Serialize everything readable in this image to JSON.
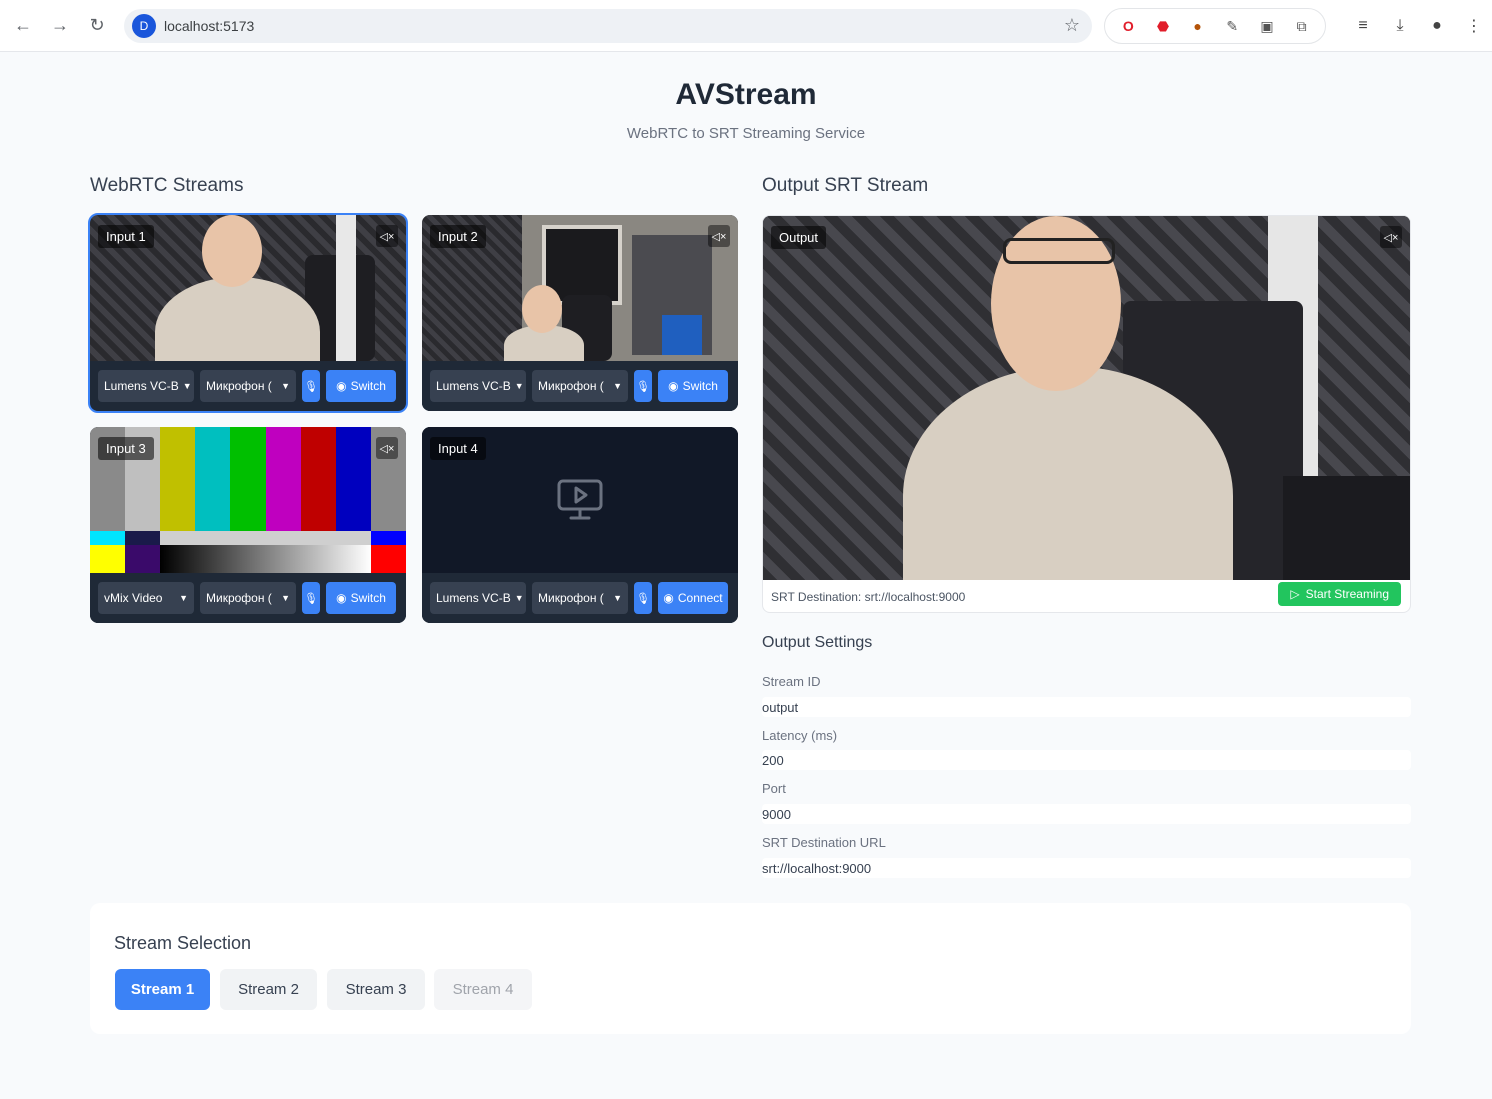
{
  "browser": {
    "url": "localhost:5173",
    "site_icon": "D"
  },
  "header": {
    "title": "AVStream",
    "subtitle": "WebRTC to SRT Streaming Service"
  },
  "webrtc": {
    "section_title": "WebRTC Streams",
    "inputs": [
      {
        "label": "Input 1",
        "video_select": "Lumens VC-B",
        "audio_select": "Микрофон (",
        "action": "Switch",
        "active": true
      },
      {
        "label": "Input 2",
        "video_select": "Lumens VC-B",
        "audio_select": "Микрофон (",
        "action": "Switch",
        "active": false
      },
      {
        "label": "Input 3",
        "video_select": "vMix Video",
        "audio_select": "Микрофон (",
        "action": "Switch",
        "active": false
      },
      {
        "label": "Input 4",
        "video_select": "Lumens VC-B",
        "audio_select": "Микрофон (",
        "action": "Connect",
        "active": false
      }
    ]
  },
  "output": {
    "section_title": "Output SRT Stream",
    "video_label": "Output",
    "destination_text": "SRT Destination: srt://localhost:9000",
    "start_button": "Start Streaming",
    "settings": {
      "title": "Output Settings",
      "stream_id_label": "Stream ID",
      "stream_id": "output",
      "latency_label": "Latency (ms)",
      "latency": "200",
      "port_label": "Port",
      "port": "9000",
      "url_label": "SRT Destination URL",
      "url": "srt://localhost:9000"
    }
  },
  "stream_selection": {
    "title": "Stream Selection",
    "buttons": [
      "Stream 1",
      "Stream 2",
      "Stream 3",
      "Stream 4"
    ],
    "selected": "Stream 1",
    "disabled": "Stream 4"
  },
  "colors": {
    "accent": "#3b82f6",
    "start": "#22c55e",
    "tile_bg": "#1f2937"
  }
}
